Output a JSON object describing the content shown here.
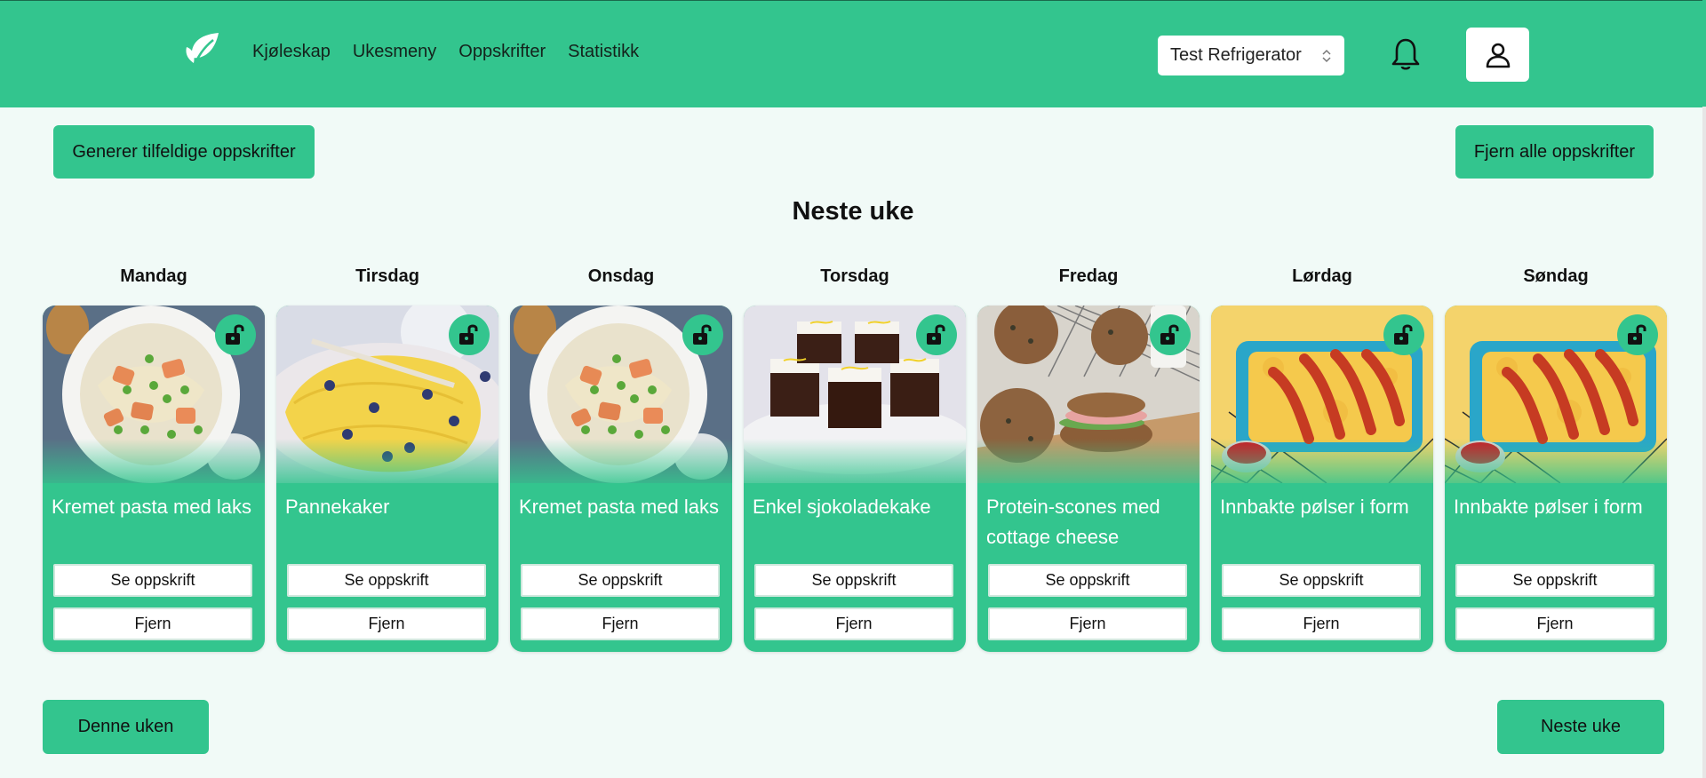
{
  "nav": {
    "items": [
      "Kjøleskap",
      "Ukesmeny",
      "Oppskrifter",
      "Statistikk"
    ],
    "fridge_selected": "Test Refrigerator"
  },
  "actions": {
    "generate": "Generer tilfeldige oppskrifter",
    "remove_all": "Fjern alle oppskrifter"
  },
  "week_title": "Neste uke",
  "card_buttons": {
    "see": "Se oppskrift",
    "remove": "Fjern"
  },
  "days": [
    {
      "day": "Mandag",
      "recipe": "Kremet pasta med laks",
      "image": "salmon-pasta"
    },
    {
      "day": "Tirsdag",
      "recipe": "Pannekaker",
      "image": "pancakes"
    },
    {
      "day": "Onsdag",
      "recipe": "Kremet pasta med laks",
      "image": "salmon-pasta"
    },
    {
      "day": "Torsdag",
      "recipe": "Enkel sjokoladekake",
      "image": "chocolate-cake"
    },
    {
      "day": "Fredag",
      "recipe": "Protein-scones med cottage cheese",
      "image": "scones"
    },
    {
      "day": "Lørdag",
      "recipe": "Innbakte pølser i form",
      "image": "sausages"
    },
    {
      "day": "Søndag",
      "recipe": "Innbakte pølser i form",
      "image": "sausages"
    }
  ],
  "footer": {
    "this_week": "Denne uken",
    "next_week": "Neste uke"
  },
  "colors": {
    "accent": "#33c58e",
    "background": "#f1faf7"
  }
}
